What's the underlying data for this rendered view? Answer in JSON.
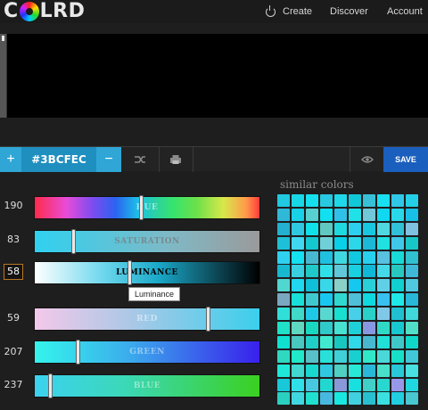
{
  "brand": {
    "name": "LRD",
    "prefix": "C"
  },
  "nav": {
    "create": "Create",
    "discover": "Discover",
    "account": "Account"
  },
  "preview": {
    "color": "#000000"
  },
  "toolbar": {
    "hex": "#3BCFEC",
    "add": "+",
    "remove": "−",
    "save": "SAVE"
  },
  "sliders": [
    {
      "id": "hue",
      "label": "HUE",
      "value": "190",
      "level": 0.47
    },
    {
      "id": "saturation",
      "label": "SATURATION",
      "value": "83",
      "level": 0.17
    },
    {
      "id": "luminance",
      "label": "LUMINANCE",
      "value": "58",
      "level": 0.42,
      "active": true
    },
    {
      "id": "red",
      "label": "RED",
      "value": "59",
      "level": 0.76
    },
    {
      "id": "green",
      "label": "GREEN",
      "value": "207",
      "level": 0.19
    },
    {
      "id": "blue",
      "label": "BLUE",
      "value": "237",
      "level": 0.06
    }
  ],
  "tooltip": "Luminance",
  "similar": {
    "title": "similar colors",
    "colors": [
      "#20c8e0",
      "#18d8e8",
      "#14e0ee",
      "#28c8e0",
      "#1ed8ea",
      "#10c8d8",
      "#38c0d8",
      "#18e0f0",
      "#30c8e8",
      "#24d0e8",
      "#30b8d8",
      "#18d0e8",
      "#58d0d0",
      "#10e0f0",
      "#30c0e8",
      "#20e0e8",
      "#70c8d8",
      "#10d8f0",
      "#28d8e8",
      "#18c0e8",
      "#24b0d0",
      "#30c8e0",
      "#10e0e8",
      "#60c8c0",
      "#20d8e0",
      "#2ed0f0",
      "#18c8e0",
      "#50d8e0",
      "#30c0d8",
      "#80c0e0",
      "#1ec0d8",
      "#40d8f0",
      "#14c8d0",
      "#70d0d8",
      "#08d0e8",
      "#2cd8e8",
      "#1cb8d8",
      "#20e0e0",
      "#40c8e8",
      "#18c8c8",
      "#30d0f0",
      "#14e0f0",
      "#48b8d0",
      "#20c0e0",
      "#40d8e0",
      "#10c8e0",
      "#28d0f0",
      "#58c0e0",
      "#18d8d8",
      "#30c0d0",
      "#18b8d0",
      "#38d0e0",
      "#20c8c8",
      "#30e0e8",
      "#60c8d8",
      "#18d0e0",
      "#10b8d8",
      "#44d8e8",
      "#28c8c0",
      "#40b8d8",
      "#50d8d0",
      "#20d8f0",
      "#10c0d8",
      "#38d8e8",
      "#8ad0c8",
      "#14c8f0",
      "#2ad0d8",
      "#60d0e8",
      "#10d0d0",
      "#50c8e0",
      "#7aa8c0",
      "#18e0d8",
      "#40c8d0",
      "#18c8f0",
      "#30d8d0",
      "#50c0d8",
      "#10d8e0",
      "#38c0f0",
      "#20e8e8",
      "#28b8d8",
      "#30e0d8",
      "#40d8c8",
      "#20c8e8",
      "#58d8d0",
      "#18e0d0",
      "#48d0e8",
      "#28d0c8",
      "#80c8e8",
      "#20c0d0",
      "#40d8d8",
      "#20e0c8",
      "#60d8c0",
      "#18d8c0",
      "#30c8c8",
      "#48e0d0",
      "#20d0d8",
      "#8898e0",
      "#30d8c8",
      "#18c8d0",
      "#50e0c8",
      "#10e0d0",
      "#48c8c0",
      "#20d0c8",
      "#40e8d0",
      "#18c8c0",
      "#30d8e8",
      "#48b8d0",
      "#20e0d8",
      "#40c8c8",
      "#10d8c8",
      "#30d8c0",
      "#20e8c8",
      "#58c0c8",
      "#28e0d8",
      "#40d0d8",
      "#18d0d0",
      "#30e8c8",
      "#4ad8d8",
      "#18e0c8",
      "#40c8d8",
      "#20e8d8",
      "#40d8d0",
      "#18d8d0",
      "#30c8e0",
      "#50d0c0",
      "#28e8d8",
      "#2ab8d8",
      "#48e0c8",
      "#28c8d8",
      "#48e0e0",
      "#18c8d8",
      "#30e0e8",
      "#48c8e0",
      "#20d8d0",
      "#8898d8",
      "#18e0e0",
      "#40d0c8",
      "#28d8d0",
      "#9898e8",
      "#20d8e0",
      "#2ad0c0",
      "#40d8e0",
      "#20e0d0",
      "#48b8e0",
      "#18e8e0",
      "#40d0e0",
      "#28c0d0",
      "#3ae0e0",
      "#20d0e0",
      "#48c8d0"
    ]
  }
}
